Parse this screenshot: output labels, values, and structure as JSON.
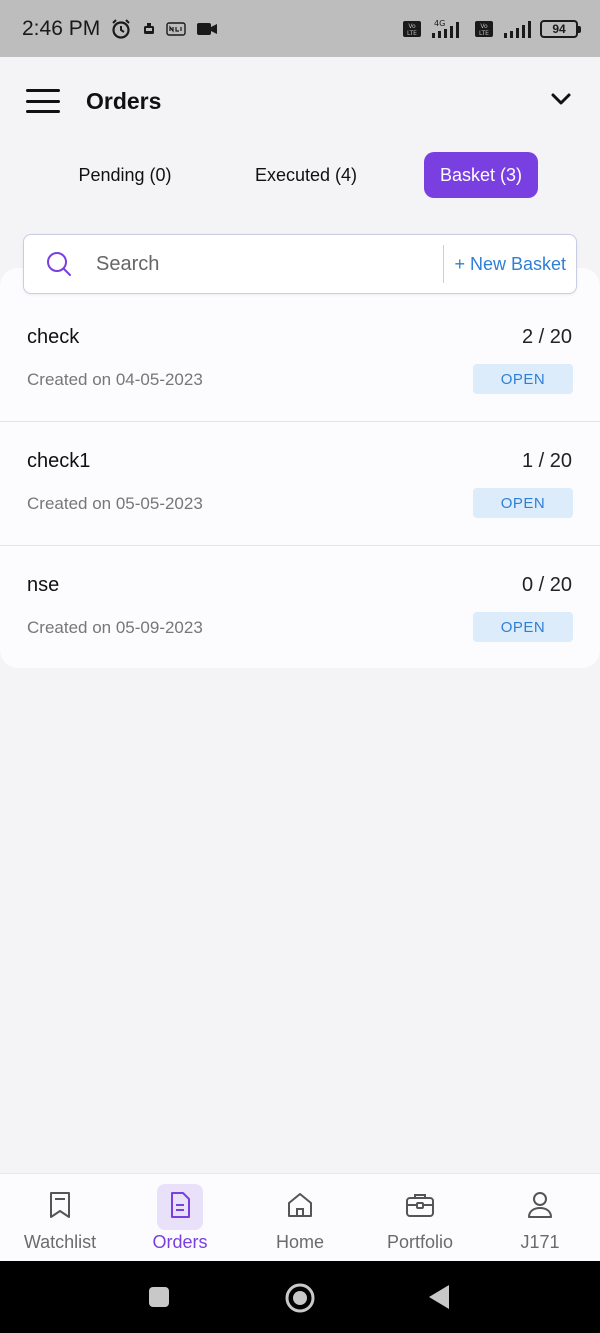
{
  "status_bar": {
    "time": "2:46 PM",
    "battery": "94"
  },
  "header": {
    "title": "Orders"
  },
  "tabs": [
    {
      "label": "Pending (0)",
      "active": false
    },
    {
      "label": "Executed (4)",
      "active": false
    },
    {
      "label": "Basket (3)",
      "active": true
    }
  ],
  "search": {
    "placeholder": "Search",
    "new_basket_label": "+ New Basket"
  },
  "baskets": [
    {
      "name": "check",
      "count": "2 / 20",
      "created": "Created on 04-05-2023",
      "status": "OPEN"
    },
    {
      "name": "check1",
      "count": "1 / 20",
      "created": "Created on 05-05-2023",
      "status": "OPEN"
    },
    {
      "name": "nse",
      "count": "0 / 20",
      "created": "Created on 05-09-2023",
      "status": "OPEN"
    }
  ],
  "bottom_nav": [
    {
      "label": "Watchlist",
      "icon": "bookmark-icon",
      "active": false
    },
    {
      "label": "Orders",
      "icon": "document-icon",
      "active": true
    },
    {
      "label": "Home",
      "icon": "home-icon",
      "active": false
    },
    {
      "label": "Portfolio",
      "icon": "briefcase-icon",
      "active": false
    },
    {
      "label": "J171",
      "icon": "user-icon",
      "active": false
    }
  ],
  "colors": {
    "accent": "#7a3fe0",
    "link": "#2f7fd6",
    "status_bg": "#dcecfa"
  }
}
